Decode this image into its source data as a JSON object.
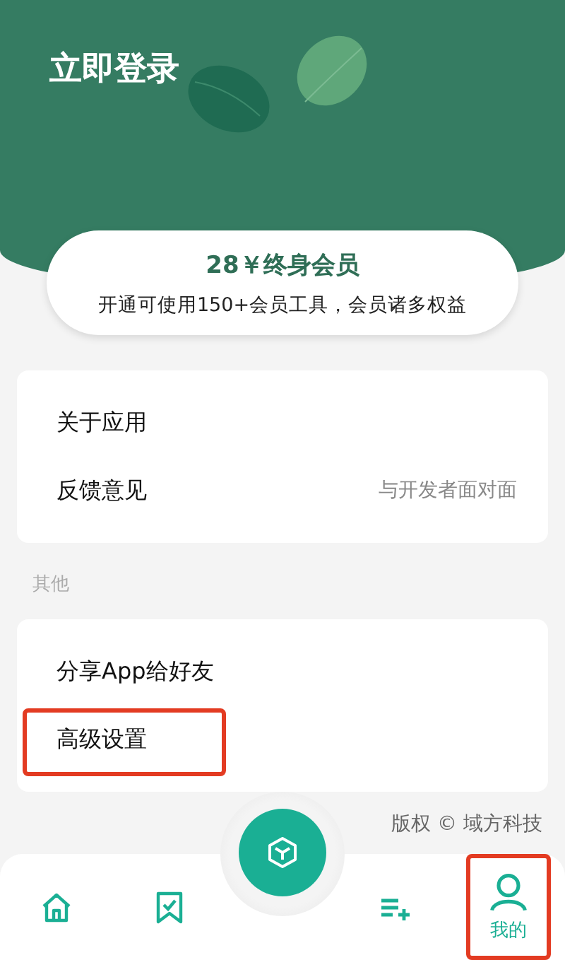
{
  "header": {
    "title": "立即登录"
  },
  "membership": {
    "price": "28￥终身会员",
    "description": "开通可使用150+会员工具，会员诸多权益"
  },
  "groups": [
    {
      "items": [
        {
          "label": "关于应用",
          "highlighted": false
        },
        {
          "label": "反馈意见",
          "hint": "与开发者面对面",
          "highlighted": false
        }
      ]
    },
    {
      "label": "其他",
      "items": [
        {
          "label": "分享App给好友",
          "highlighted": false
        },
        {
          "label": "高级设置",
          "highlighted": true
        }
      ]
    }
  ],
  "copyright": "版权 © 域方科技",
  "tabs": [
    {
      "kind": "tab",
      "selected": false,
      "highlighted": false
    },
    {
      "kind": "tab",
      "selected": false,
      "highlighted": false
    },
    {
      "kind": "center",
      "selected": false,
      "highlighted": false
    },
    {
      "kind": "tab",
      "selected": false,
      "highlighted": false
    },
    {
      "kind": "tab",
      "label": "我的",
      "selected": true,
      "highlighted": true
    }
  ]
}
